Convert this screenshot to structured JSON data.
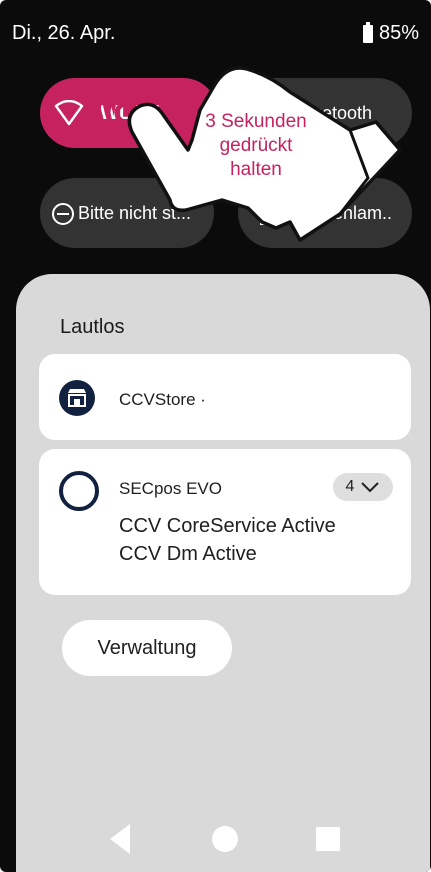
{
  "status_bar": {
    "date": "Di., 26. Apr.",
    "battery": "85%"
  },
  "quick_settings": {
    "wlan_label": "WLAN",
    "bluetooth_label": "Bluetooth",
    "dnd_label": "Bitte nicht st...",
    "torch_label": "Taschenlam.."
  },
  "annotation": {
    "line1": "3 Sekunden",
    "line2": "gedrückt",
    "line3": "halten",
    "color": "#c6225f"
  },
  "panel": {
    "title": "Lautlos",
    "notifications": [
      {
        "app": "CCVStore ·"
      },
      {
        "app": "SECpos EVO",
        "count": "4",
        "lines": [
          "CCV CoreService Active",
          "CCV Dm Active"
        ]
      }
    ],
    "manage_label": "Verwaltung"
  },
  "colors": {
    "accent": "#c6225f",
    "tile": "#333333",
    "panel": "#d9d9d9",
    "app_icon": "#12213f"
  },
  "icons": {
    "wifi": "wifi-icon",
    "bluetooth": "bluetooth-icon",
    "dnd": "do-not-disturb-icon",
    "torch": "flashlight-icon",
    "store": "store-icon",
    "app_ring": "ring-icon",
    "expand": "chevron-down-icon",
    "hand": "pointing-hand-icon"
  }
}
